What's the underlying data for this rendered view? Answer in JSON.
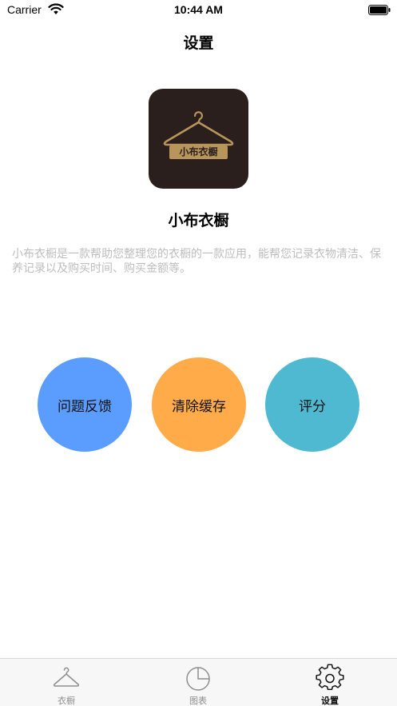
{
  "status_bar": {
    "carrier": "Carrier",
    "time": "10:44 AM",
    "wifi_icon": "wifi-icon",
    "battery_icon": "battery-icon"
  },
  "nav": {
    "title": "设置"
  },
  "app": {
    "logo_text": "小布衣橱",
    "name": "小布衣橱",
    "description": "小布衣橱是一款帮助您整理您的衣橱的一款应用，能帮您记录衣物清洁、保养记录以及购买时间、购买金额等。"
  },
  "actions": {
    "feedback_label": "问题反馈",
    "clear_cache_label": "清除缓存",
    "rate_label": "评分"
  },
  "tabs": [
    {
      "label": "衣橱",
      "icon": "hanger-icon",
      "active": false
    },
    {
      "label": "图表",
      "icon": "pie-chart-icon",
      "active": false
    },
    {
      "label": "设置",
      "icon": "gear-icon",
      "active": true
    }
  ],
  "colors": {
    "feedback": "#5b9dff",
    "clear_cache": "#ffab4a",
    "rate": "#4fb9d2",
    "logo_bg": "#2b1f1e",
    "logo_gold": "#b8955a"
  }
}
